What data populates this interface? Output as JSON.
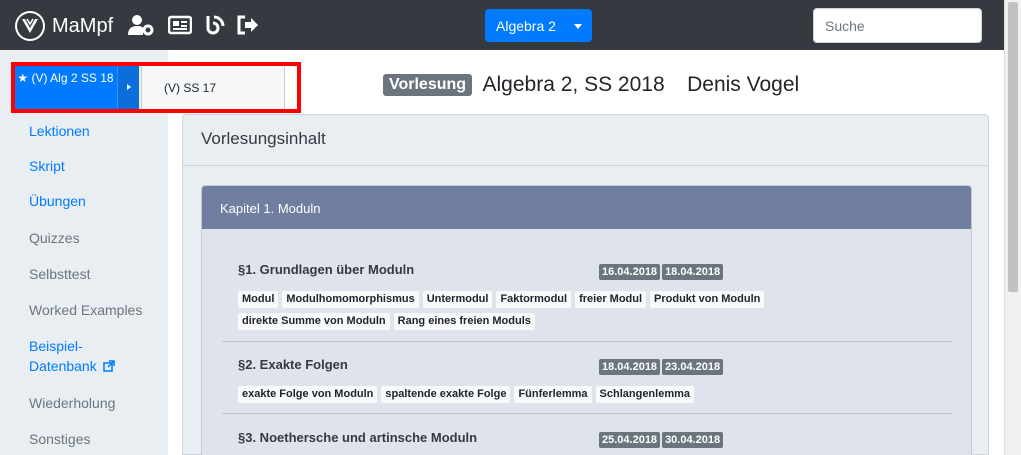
{
  "navbar": {
    "brand": "MaMpf",
    "icons": [
      "user-cog-icon",
      "newspaper-icon",
      "feed-icon",
      "logout-icon"
    ],
    "course_select": "Algebra 2",
    "search_placeholder": "Suche"
  },
  "version_switcher": {
    "active_label": "★ (V) Alg 2 SS 18",
    "menu_item": "(V) SS 17"
  },
  "sidebar": {
    "items": [
      {
        "label": "Lektionen",
        "link": true
      },
      {
        "label": "Skript",
        "link": true
      },
      {
        "label": "Übungen",
        "link": true
      },
      {
        "label": "Quizzes",
        "link": false
      },
      {
        "label": "Selbsttest",
        "link": false
      },
      {
        "label": "Worked Examples",
        "link": false
      },
      {
        "label": "Beispiel-",
        "link": true
      },
      {
        "label": "Datenbank",
        "link": true
      },
      {
        "label": "Wiederholung",
        "link": false
      },
      {
        "label": "Sonstiges",
        "link": false
      }
    ]
  },
  "header": {
    "badge": "Vorlesung",
    "title": "Algebra 2, SS 2018",
    "teacher": "Denis Vogel"
  },
  "content": {
    "card_title": "Vorlesungsinhalt",
    "chapter_title": "Kapitel 1. Moduln",
    "sections": [
      {
        "title": "§1. Grundlagen über Moduln",
        "dates": [
          "16.04.2018",
          "18.04.2018"
        ],
        "tags": [
          "Modul",
          "Modulhomomorphismus",
          "Untermodul",
          "Faktormodul",
          "freier Modul",
          "Produkt von Moduln",
          "direkte Summe von Moduln",
          "Rang eines freien Moduls"
        ]
      },
      {
        "title": "§2. Exakte Folgen",
        "dates": [
          "18.04.2018",
          "23.04.2018"
        ],
        "tags": [
          "exakte Folge von Moduln",
          "spaltende exakte Folge",
          "Fünferlemma",
          "Schlangenlemma"
        ]
      },
      {
        "title": "§3. Noethersche und artinsche Moduln",
        "dates": [
          "25.04.2018",
          "30.04.2018"
        ],
        "tags": []
      }
    ]
  },
  "colors": {
    "navbar": "#343a40",
    "primary": "#007bff",
    "highlight": "#ff0000",
    "chapter_header": "#707f9f"
  }
}
